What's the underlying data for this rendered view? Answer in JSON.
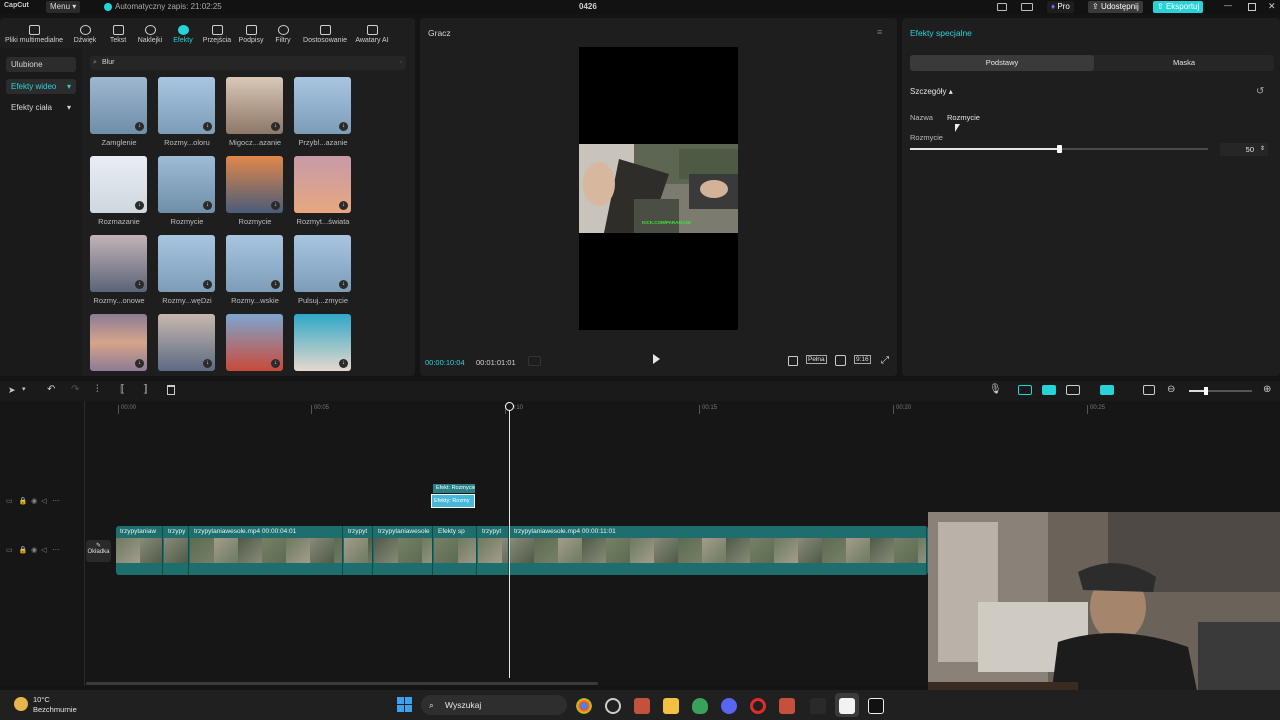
{
  "titlebar": {
    "app_name": "CapCut",
    "menu_label": "Menu",
    "autosave": "Automatyczny zapis: 21:02:25",
    "project_name": "0426",
    "pro_label": "Pro",
    "share_label": "Udostępnij",
    "export_label": "Eksportuj",
    "accent_color": "#28d3d8"
  },
  "toolbar": {
    "tools": [
      {
        "label": "Pliki multimedialne",
        "icon": "media-icon"
      },
      {
        "label": "Dźwięk",
        "icon": "audio-icon"
      },
      {
        "label": "Tekst",
        "icon": "text-icon"
      },
      {
        "label": "Naklejki",
        "icon": "sticker-icon"
      },
      {
        "label": "Efekty",
        "icon": "effects-icon"
      },
      {
        "label": "Przejścia",
        "icon": "transitions-icon"
      },
      {
        "label": "Podpisy",
        "icon": "captions-icon"
      },
      {
        "label": "Filtry",
        "icon": "filters-icon"
      },
      {
        "label": "Dostosowanie",
        "icon": "adjust-icon"
      },
      {
        "label": "Awatary AI",
        "icon": "avatar-icon"
      }
    ],
    "active": "Efekty"
  },
  "effects_panel": {
    "categories": [
      "Ulubione",
      "Efekty wideo",
      "Efekty ciała"
    ],
    "search_value": "Blur",
    "items": [
      {
        "label": "Zamglenie"
      },
      {
        "label": "Rozmy...oloru"
      },
      {
        "label": "Migocz...azanie"
      },
      {
        "label": "Przybl...azanie"
      },
      {
        "label": "Rozmazanie"
      },
      {
        "label": "Rozmycie"
      },
      {
        "label": "Rozmycie"
      },
      {
        "label": "Rozmyt...świata"
      },
      {
        "label": "Rozmy...onowe"
      },
      {
        "label": "Rozmy...węDzi"
      },
      {
        "label": "Rozmy...wskie"
      },
      {
        "label": "Pulsuj...zmycie"
      },
      {
        "label": ""
      },
      {
        "label": ""
      },
      {
        "label": ""
      },
      {
        "label": ""
      }
    ]
  },
  "player": {
    "title": "Gracz",
    "current_time": "00:00:10:04",
    "total_time": "00:01:01:01",
    "full_label": "Pełna",
    "ratio_label": "9:16",
    "watermark": "KICK.COM/PARAMAZE"
  },
  "right_panel": {
    "title": "Efekty specjalne",
    "tabs": [
      "Podstawy",
      "Maska"
    ],
    "section": "Szczegóły",
    "name_label": "Nazwa",
    "name_value": "Rozmycie",
    "param_label": "Rozmycie",
    "param_value": "50",
    "param_fraction": 0.5
  },
  "timeline": {
    "ruler": [
      "00:00",
      "00:05",
      "00:10",
      "00:15",
      "00:20",
      "00:25"
    ],
    "effect_clip_label": "Efekt: Rozmycie",
    "effect_clip_sub": "Efekty: Rozmy",
    "cover_label": "Okładka",
    "clips": [
      {
        "label": "trzypytaniaw"
      },
      {
        "label": "trzypy"
      },
      {
        "label": "trzypytaniawesole.mp4  00:00:04:01"
      },
      {
        "label": "trzypyt"
      },
      {
        "label": "trzypytaniawesole"
      },
      {
        "label": "Efekty sp"
      },
      {
        "label": "trzypyt"
      },
      {
        "label": "trzypytaniawesole.mp4  00:00:11:01"
      }
    ]
  },
  "taskbar": {
    "temperature": "10°C",
    "weather": "Bezchmurnie",
    "search_placeholder": "Wyszukaj"
  }
}
